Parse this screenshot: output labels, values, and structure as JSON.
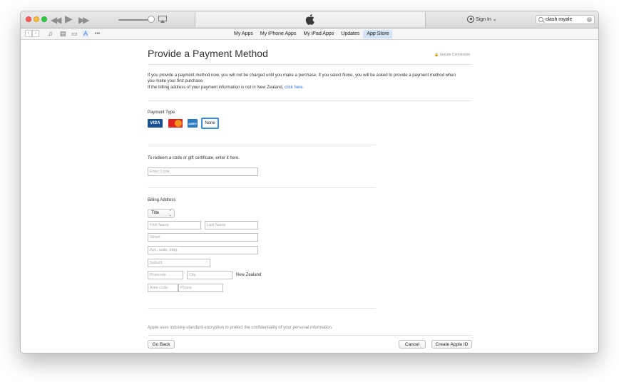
{
  "titlebar": {
    "sign_in_label": "Sign In",
    "sign_in_caret": "⌄",
    "search_value": "clash royale",
    "search_clear_glyph": "×"
  },
  "toolbar": {
    "back_glyph": "‹",
    "forward_glyph": "›",
    "icons": [
      "music-icon",
      "movies-icon",
      "tv-icon",
      "app-store-icon",
      "more-icon"
    ],
    "icon_glyphs": [
      "♫",
      "▤",
      "▭",
      "A",
      "•••"
    ],
    "tabs": [
      "My Apps",
      "My iPhone Apps",
      "My iPad Apps",
      "Updates",
      "App Store"
    ],
    "selected_tab": "App Store"
  },
  "page": {
    "title": "Provide a Payment Method",
    "secure_label": "Secure Connection",
    "intro_line1": "If you provide a payment method now, you will not be charged until you make a purchase. If you select None, you will be asked to provide a payment method when you make your first purchase.",
    "intro_line2_prefix": "If the billing address of your payment information is not in New Zealand, ",
    "intro_line2_link": "click here",
    "intro_line2_suffix": "."
  },
  "payment": {
    "heading": "Payment Type",
    "cards": [
      "VISA",
      "MasterCard",
      "AMEX"
    ],
    "none_label": "None",
    "selected": "None"
  },
  "redeem": {
    "prompt": "To redeem a code or gift certificate, enter it here.",
    "placeholder": "Enter Code"
  },
  "billing": {
    "heading": "Billing Address",
    "title_select": "Title",
    "first_name": "First Name",
    "last_name": "Last Name",
    "street": "Street",
    "apt": "Apt., suite, bldg.",
    "suburb": "Suburb",
    "postcode": "Postcode",
    "city": "City",
    "country": "New Zealand",
    "area_code": "Area code",
    "phone": "Phone"
  },
  "footer": {
    "encryption_note": "Apple uses industry-standard encryption to protect the confidentiality of your personal information.",
    "go_back": "Go Back",
    "cancel": "Cancel",
    "create_apple_id": "Create Apple ID"
  },
  "colors": {
    "accent": "#3d8ddb",
    "link": "#2a72d4",
    "visa": "#1a4f96",
    "mastercard": "#d7261f",
    "amex": "#2b7cc2"
  }
}
